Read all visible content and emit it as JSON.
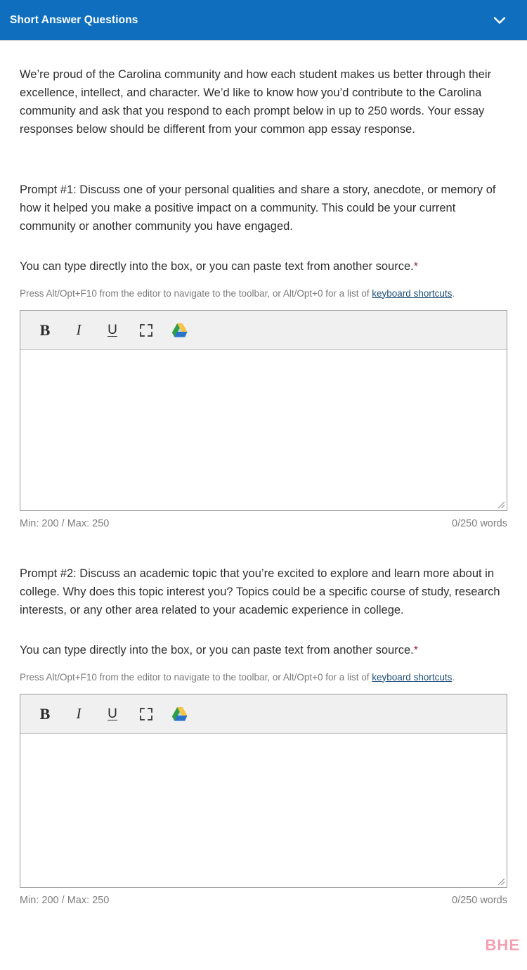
{
  "header": {
    "title": "Short Answer Questions",
    "collapse_icon": "chevron-down-icon",
    "accent_color": "#0f6fbe"
  },
  "intro": {
    "text": "We’re proud of the Carolina community and how each student makes us better through their excellence, intellect, and character.  We’d like to know how you’d contribute to the Carolina community and ask that you respond to each prompt below in up to 250 words. Your essay responses below should be different from your common app essay response."
  },
  "common": {
    "type_note": "You can type directly into the box, or you can paste text from another source.",
    "required_marker": "*",
    "required_color": "#a01b2b",
    "a11y_prefix": "Press Alt/Opt+F10 from the editor to navigate to the toolbar, or Alt/Opt+0 for a list of ",
    "a11y_link": "keyboard shortcuts",
    "a11y_suffix": ".",
    "toolbar": {
      "bold_label": "B",
      "italic_label": "I",
      "underline_label": "U",
      "fullscreen_icon": "fullscreen-icon",
      "drive_icon": "google-drive-icon"
    },
    "textarea_placeholder": "",
    "textarea_value": "",
    "limits_label": "Min: 200 / Max: 250",
    "word_count_label": "0/250 words"
  },
  "prompts": [
    {
      "text": "Prompt #1: Discuss one of your personal qualities and share a story, anecdote, or memory of how it helped you make a positive impact on a community. This could be your current community or another community you have engaged."
    },
    {
      "text": "Prompt #2: Discuss an academic topic that you’re excited to explore and learn more about in college. Why does this topic interest you? Topics could be a specific course of study, research interests, or any other area related to your academic experience in college."
    }
  ],
  "watermark": {
    "text": "BHE",
    "color": "#f59aad"
  }
}
